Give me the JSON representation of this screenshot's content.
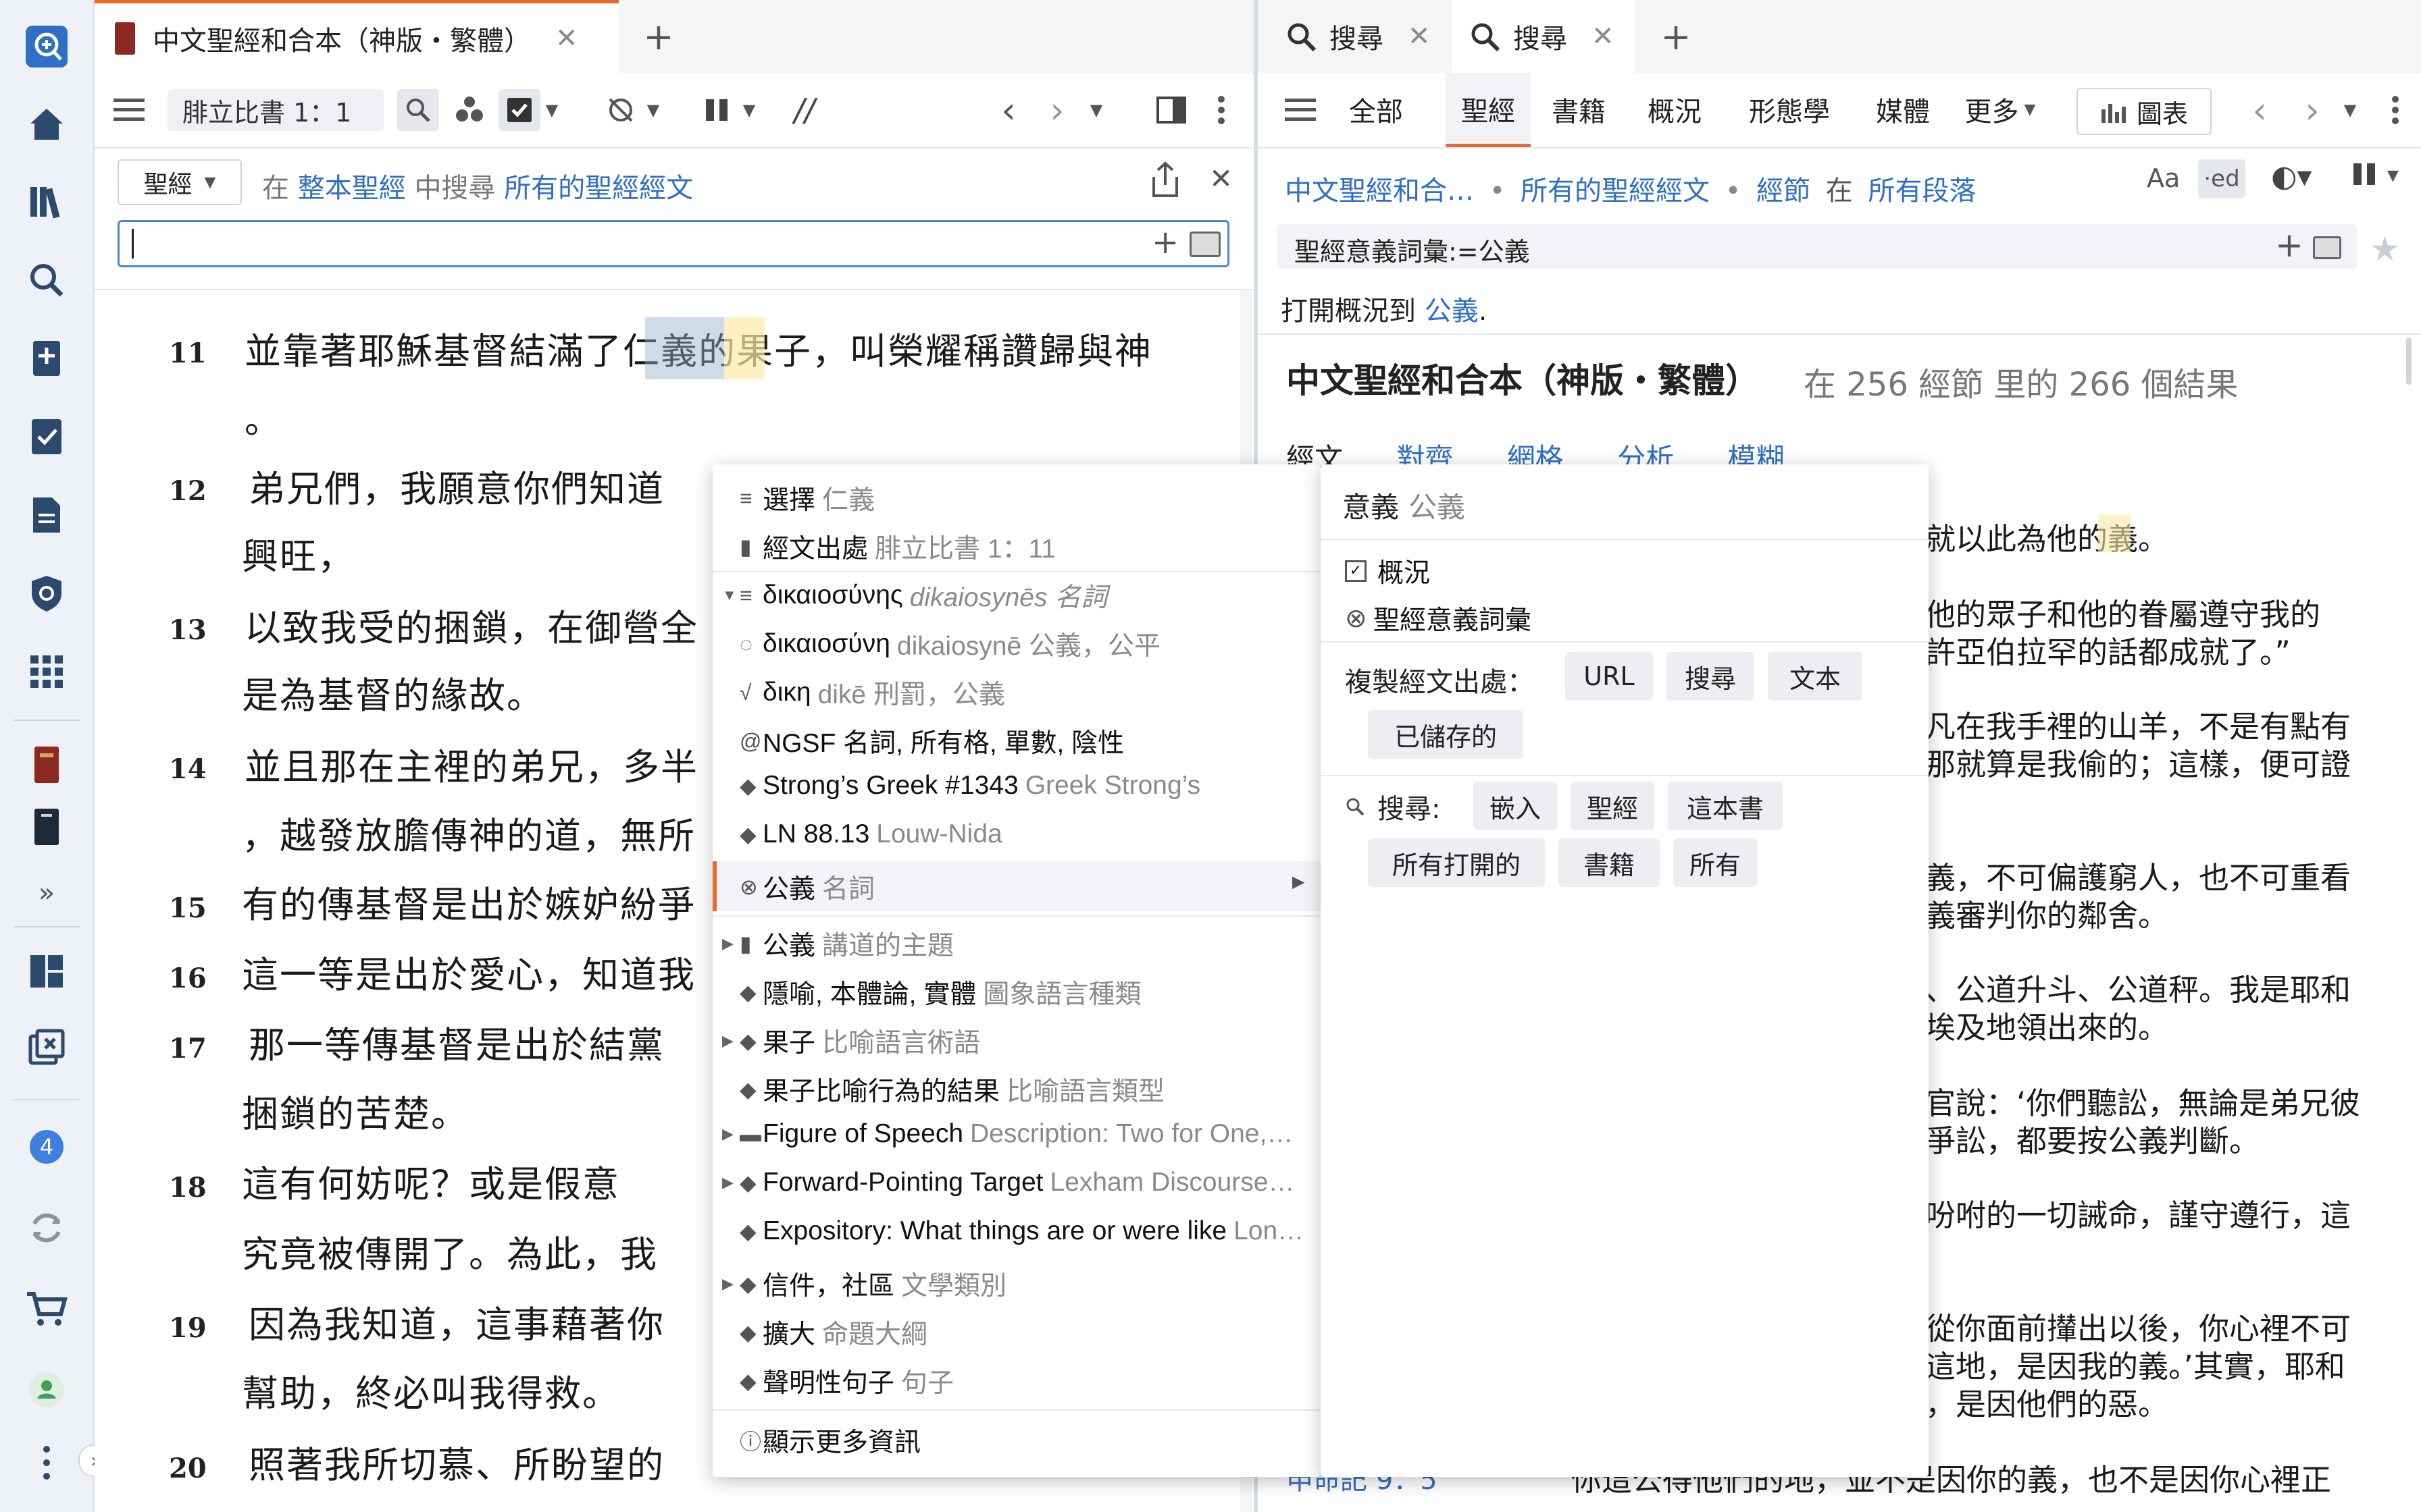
{
  "sidebar": {
    "badge_count": "4",
    "icons": [
      "search-plus-icon",
      "home-icon",
      "library-icon",
      "search-icon",
      "notes-icon",
      "checklist-icon",
      "document-icon",
      "shield-icon",
      "apps-grid-icon",
      "book-red-icon",
      "book-dark-icon",
      "expand-icon",
      "layout-icon",
      "close-panels-icon",
      "badge-icon",
      "sync-icon",
      "cart-icon",
      "user-icon",
      "more-icon"
    ]
  },
  "left_panel": {
    "tab_title": "中文聖經和合本（神版・繁體）",
    "tab_new": "+",
    "reference": "腓立比書 1：1",
    "search_scope_label": "聖經",
    "search_hint_prefix": "在",
    "search_hint_scope": "整本聖經",
    "search_hint_mid": "中搜尋",
    "search_hint_target": "所有的聖經經文",
    "search_input_value": "",
    "verses": [
      {
        "num": "11",
        "lines": [
          "並靠著耶穌基督結滿了仁義的果子，叫榮耀稱讚歸與神",
          "。"
        ]
      },
      {
        "num": "12",
        "lines": [
          "弟兄們，我願意你們知道",
          "興旺，"
        ]
      },
      {
        "num": "13",
        "lines": [
          "以致我受的捆鎖，在御營全",
          "是為基督的緣故。"
        ]
      },
      {
        "num": "14",
        "lines": [
          "並且那在主裡的弟兄，多半",
          "，越發放膽傳神的道，無所"
        ]
      },
      {
        "num": "15",
        "lines": [
          "有的傳基督是出於嫉妒紛爭"
        ]
      },
      {
        "num": "16",
        "lines": [
          "這一等是出於愛心，知道我"
        ]
      },
      {
        "num": "17",
        "lines": [
          "那一等傳基督是出於結黨",
          "捆鎖的苦楚。"
        ]
      },
      {
        "num": "18",
        "lines": [
          "這有何妨呢？或是假意",
          "究竟被傳開了。為此，我"
        ]
      },
      {
        "num": "19",
        "lines": [
          "因為我知道，這事藉著你",
          "幫助，終必叫我得救。"
        ]
      },
      {
        "num": "20",
        "lines": [
          "照著我所切慕、所盼望的"
        ]
      }
    ]
  },
  "context_menu": {
    "items": [
      {
        "icon": "≡",
        "label": "選擇",
        "gray": "仁義"
      },
      {
        "icon": "▮",
        "label": "經文出處",
        "gray": "腓立比書 1：11"
      },
      {
        "icon": "≡",
        "label": "δικαιοσύνης",
        "gray": "dikaiosynēs 名詞"
      },
      {
        "icon": "◌",
        "label": "δικαιοσύνη",
        "gray": "dikaiosynē 公義，公平"
      },
      {
        "icon": "√",
        "label": "δικη",
        "gray": "dikē 刑罰，公義"
      },
      {
        "icon": "@",
        "label": "NGSF 名詞, 所有格, 單數, 陰性",
        "gray": ""
      },
      {
        "icon": "◆",
        "label": "Strong’s Greek #1343",
        "gray": "Greek Strong’s"
      },
      {
        "icon": "◆",
        "label": "LN 88.13",
        "gray": "Louw-Nida"
      },
      {
        "icon": "⊗",
        "label": "公義",
        "gray": "名詞"
      },
      {
        "icon": "▮",
        "label": "公義",
        "gray": "講道的主題"
      },
      {
        "icon": "◆",
        "label": "隱喻, 本體論, 實體",
        "gray": "圖象語言種類"
      },
      {
        "icon": "◆",
        "label": "果子",
        "gray": "比喻語言術語"
      },
      {
        "icon": "◆",
        "label": "果子比喻行為的結果",
        "gray": "比喻語言類型"
      },
      {
        "icon": "▬",
        "label": "Figure of Speech",
        "gray": "Description: Two for One,…"
      },
      {
        "icon": "◆",
        "label": "Forward-Pointing Target",
        "gray": "Lexham Discourse…"
      },
      {
        "icon": "◆",
        "label": "Expository: What things are or were like",
        "gray": "Lon…"
      },
      {
        "icon": "◆",
        "label": "信件，社區",
        "gray": "文學類別"
      },
      {
        "icon": "◆",
        "label": "擴大",
        "gray": "命題大綱"
      },
      {
        "icon": "◆",
        "label": "聲明性句子",
        "gray": "句子"
      }
    ],
    "more_info": "顯示更多資訊"
  },
  "submenu": {
    "title": "意義",
    "title_gray": "公義",
    "options": [
      "概況",
      "聖經意義詞彙"
    ],
    "copy_label": "複製經文出處：",
    "copy_buttons": [
      "URL",
      "搜尋",
      "文本",
      "已儲存的"
    ],
    "search_label": "搜尋:",
    "search_buttons": [
      "嵌入",
      "聖經",
      "這本書",
      "所有打開的",
      "書籍",
      "所有"
    ]
  },
  "right_panel": {
    "tabs": [
      {
        "label": "搜尋",
        "close": "✕"
      },
      {
        "label": "搜尋",
        "close": "✕"
      }
    ],
    "tab_new": "+",
    "nav": [
      "全部",
      "聖經",
      "書籍",
      "概況",
      "形態學",
      "媒體",
      "更多"
    ],
    "chart_button": "圖表",
    "breadcrumb": [
      "中文聖經和合…",
      "所有的聖經經文",
      "經節",
      "在",
      "所有段落"
    ],
    "query": "聖經意義詞彙:=公義",
    "open_prefix": "打開概況到",
    "open_link": "公義",
    "result_title": "中文聖經和合本（神版・繁體）",
    "result_count": "在 256 經節 里的 266 個結果",
    "subtabs": [
      "經文",
      "對齊",
      "網格",
      "分析",
      "模糊"
    ],
    "result_lines": [
      "就以此為他的義。",
      "他的眾子和他的眷屬遵守我的",
      "許亞伯拉罕的話都成就了。”",
      "凡在我手裡的山羊，不是有點有",
      "那就算是我偷的；這樣，便可證",
      "義，不可偏護窮人，也不可重看",
      "義審判你的鄰舍。",
      "、公道升斗、公道秤。我是耶和",
      "埃及地領出來的。",
      "官說：‘你們聽訟，無論是弟兄彼",
      "爭訟，都要按公義判斷。",
      "吩咐的一切誡命，謹守遵行，這",
      "從你面前攆出以後，你心裡不可",
      "這地，是因我的義。’其實，耶和",
      "，是因他們的惡。",
      "你這公得他們的地，並不是因你的義，也不是因你心裡正"
    ],
    "partial_ref": "申命記 9：5"
  }
}
